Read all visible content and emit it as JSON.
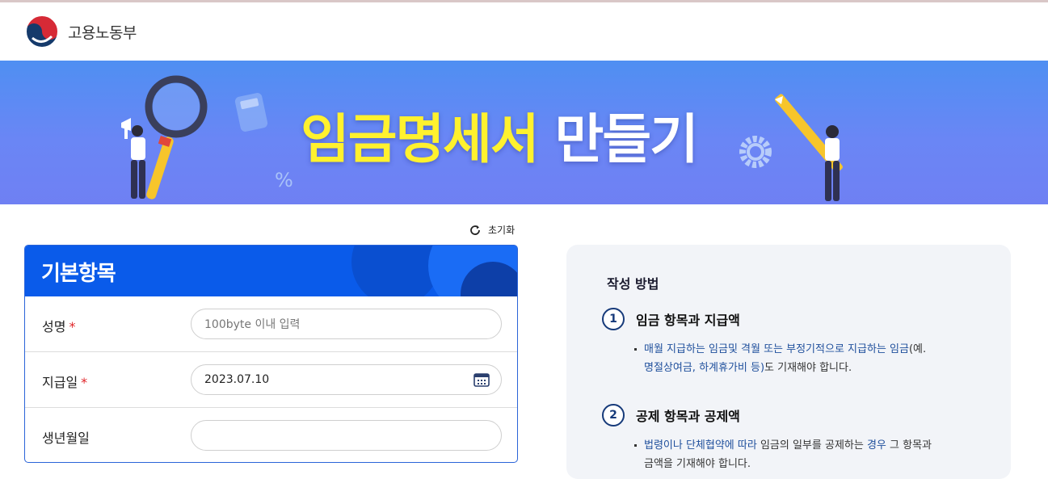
{
  "header": {
    "logo_text": "고용노동부"
  },
  "banner": {
    "title_highlight": "임금명세서",
    "title_rest": "만들기"
  },
  "toolbar": {
    "reset_label": "초기화"
  },
  "form": {
    "section_title": "기본항목",
    "fields": [
      {
        "label": "성명",
        "required_mark": "*",
        "placeholder": "100byte 이내 입력",
        "value": ""
      },
      {
        "label": "지급일",
        "required_mark": "*",
        "placeholder": "",
        "value": "2023.07.10"
      },
      {
        "label": "생년월일",
        "required_mark": "",
        "placeholder": "",
        "value": ""
      }
    ]
  },
  "guide": {
    "title": "작성 방법",
    "steps": [
      {
        "number": "1",
        "title": "임금 항목과 지급액",
        "body_parts": [
          "매월 지급하는 임금및 격월 또는 부정기적으로 지급하는 임금",
          "(예.",
          "명절상여금, 하계휴가비 등)",
          "도 기재해야 합니다."
        ]
      },
      {
        "number": "2",
        "title": "공제 항목과 공제액",
        "body_parts": [
          "법령이나 단체협약에 따라",
          " 임금의 일부를 공제하는 ",
          "경우",
          " 그 항목과",
          "금액을 기재해야 합니다."
        ]
      }
    ]
  },
  "colors": {
    "banner_yellow": "#fff12e",
    "card_blue": "#0a5bea",
    "required_red": "#e0262a",
    "step_navy": "#163a7a"
  }
}
